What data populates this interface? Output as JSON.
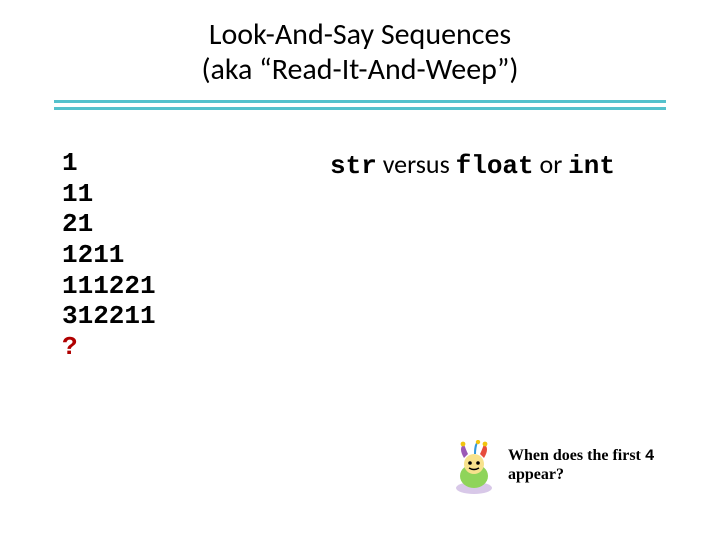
{
  "title": {
    "line1": "Look-And-Say Sequences",
    "line2": "(aka “Read-It-And-Weep”)"
  },
  "sequence": [
    "1",
    "11",
    "21",
    "1211",
    "111221",
    "312211"
  ],
  "sequence_question": "?",
  "versus": {
    "str": "str",
    "word_versus": " versus ",
    "float": "float",
    "word_or": " or ",
    "int": "int"
  },
  "caption": {
    "part1": "When does the first ",
    "digit": "4",
    "part2": " appear?"
  },
  "icons": {
    "jester": "jester-icon"
  },
  "colors": {
    "rule": "#55c1cc",
    "question": "#b00000"
  }
}
